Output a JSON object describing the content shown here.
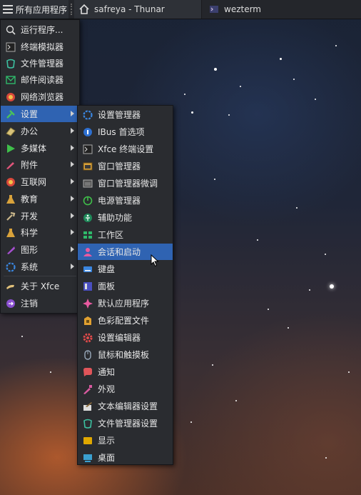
{
  "panel": {
    "app_menu_label": "所有应用程序",
    "tasks": [
      {
        "label": "safreya - Thunar",
        "icon": "home-icon"
      },
      {
        "label": "wezterm",
        "icon": "terminal-icon"
      }
    ]
  },
  "main_menu": {
    "items": [
      {
        "label": "运行程序...",
        "icon": "search-icon"
      },
      {
        "label": "终端模拟器",
        "icon": "terminal-icon"
      },
      {
        "label": "文件管理器",
        "icon": "file-manager-icon"
      },
      {
        "label": "邮件阅读器",
        "icon": "mail-icon"
      },
      {
        "label": "网络浏览器",
        "icon": "globe-icon"
      },
      {
        "label": "设置",
        "icon": "settings-icon",
        "submenu": true,
        "active": true
      },
      {
        "label": "办公",
        "icon": "office-icon",
        "submenu": true
      },
      {
        "label": "多媒体",
        "icon": "multimedia-icon",
        "submenu": true
      },
      {
        "label": "附件",
        "icon": "accessories-icon",
        "submenu": true
      },
      {
        "label": "互联网",
        "icon": "internet-icon",
        "submenu": true
      },
      {
        "label": "教育",
        "icon": "education-icon",
        "submenu": true
      },
      {
        "label": "开发",
        "icon": "development-icon",
        "submenu": true
      },
      {
        "label": "科学",
        "icon": "science-icon",
        "submenu": true
      },
      {
        "label": "图形",
        "icon": "graphics-icon",
        "submenu": true
      },
      {
        "label": "系统",
        "icon": "system-icon",
        "submenu": true
      },
      {
        "label": "关于 Xfce",
        "icon": "about-icon"
      },
      {
        "label": "注销",
        "icon": "logout-icon"
      }
    ]
  },
  "settings_submenu": {
    "items": [
      {
        "label": "设置管理器",
        "icon": "settings-manager-icon"
      },
      {
        "label": "IBus 首选项",
        "icon": "ibus-icon"
      },
      {
        "label": "Xfce 终端设置",
        "icon": "terminal-settings-icon"
      },
      {
        "label": "窗口管理器",
        "icon": "window-manager-icon"
      },
      {
        "label": "窗口管理器微调",
        "icon": "window-tweaks-icon"
      },
      {
        "label": "电源管理器",
        "icon": "power-icon"
      },
      {
        "label": "辅助功能",
        "icon": "accessibility-icon"
      },
      {
        "label": "工作区",
        "icon": "workspaces-icon"
      },
      {
        "label": "会话和启动",
        "icon": "session-icon",
        "hover": true
      },
      {
        "label": "键盘",
        "icon": "keyboard-icon"
      },
      {
        "label": "面板",
        "icon": "panel-icon"
      },
      {
        "label": "默认应用程序",
        "icon": "default-apps-icon"
      },
      {
        "label": "色彩配置文件",
        "icon": "color-profile-icon"
      },
      {
        "label": "设置编辑器",
        "icon": "settings-editor-icon"
      },
      {
        "label": "鼠标和触摸板",
        "icon": "mouse-icon"
      },
      {
        "label": "通知",
        "icon": "notifications-icon"
      },
      {
        "label": "外观",
        "icon": "appearance-icon"
      },
      {
        "label": "文本编辑器设置",
        "icon": "text-editor-icon"
      },
      {
        "label": "文件管理器设置",
        "icon": "file-manager-settings-icon"
      },
      {
        "label": "显示",
        "icon": "display-icon"
      },
      {
        "label": "桌面",
        "icon": "desktop-icon"
      }
    ]
  }
}
